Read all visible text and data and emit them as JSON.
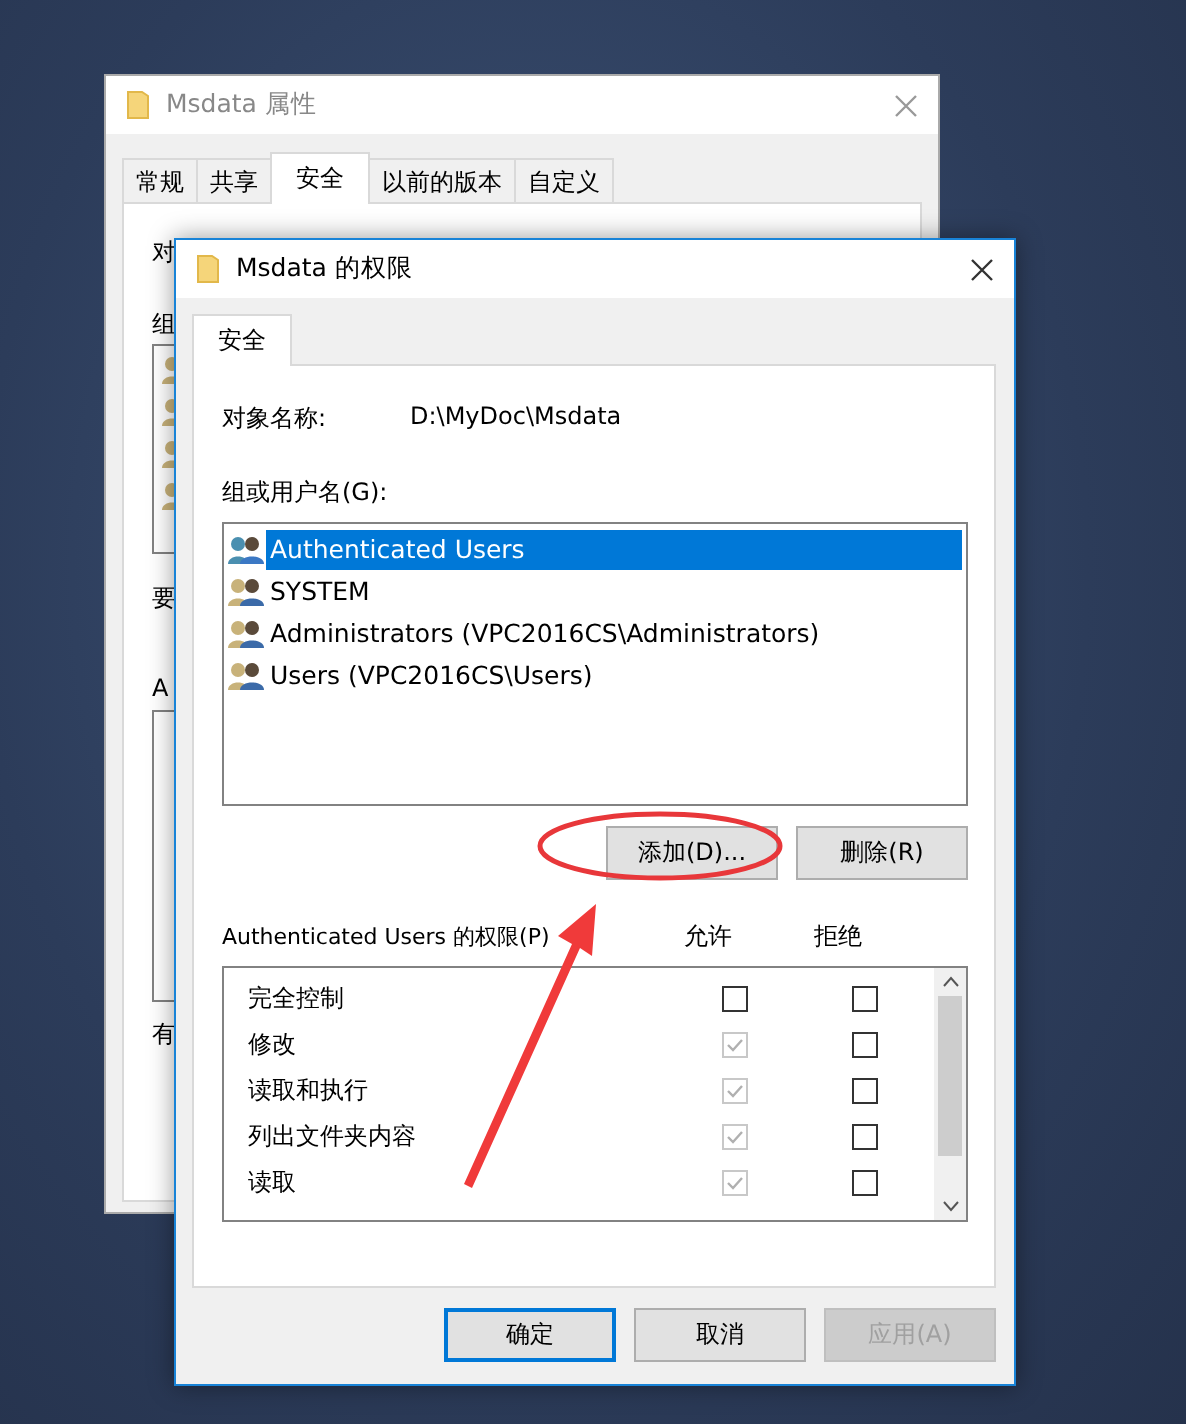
{
  "back_window": {
    "title": "Msdata 属性",
    "tabs": [
      {
        "label": "常规",
        "selected": false
      },
      {
        "label": "共享",
        "selected": false
      },
      {
        "label": "安全",
        "selected": true
      },
      {
        "label": "以前的版本",
        "selected": false
      },
      {
        "label": "自定义",
        "selected": false
      }
    ],
    "labels": [
      "对",
      "组",
      "要",
      "A",
      "有"
    ]
  },
  "dialog": {
    "title": "Msdata 的权限",
    "tabs": [
      {
        "label": "安全",
        "selected": true
      }
    ],
    "object_name_label": "对象名称:",
    "object_name": "D:\\MyDoc\\Msdata",
    "group_label": "组或用户名(G):",
    "users": [
      {
        "name": "Authenticated Users",
        "kind": "group",
        "selected": true
      },
      {
        "name": "SYSTEM",
        "kind": "user",
        "selected": false
      },
      {
        "name": "Administrators (VPC2016CS\\Administrators)",
        "kind": "user",
        "selected": false
      },
      {
        "name": "Users (VPC2016CS\\Users)",
        "kind": "user",
        "selected": false
      }
    ],
    "add_button": "添加(D)...",
    "remove_button": "删除(R)",
    "permissions_label": "Authenticated Users 的权限(P)",
    "allow_header": "允许",
    "deny_header": "拒绝",
    "permissions": [
      {
        "name": "完全控制",
        "allow_checked": false,
        "allow_disabled": false,
        "deny_checked": false
      },
      {
        "name": "修改",
        "allow_checked": true,
        "allow_disabled": true,
        "deny_checked": false
      },
      {
        "name": "读取和执行",
        "allow_checked": true,
        "allow_disabled": true,
        "deny_checked": false
      },
      {
        "name": "列出文件夹内容",
        "allow_checked": true,
        "allow_disabled": true,
        "deny_checked": false
      },
      {
        "name": "读取",
        "allow_checked": true,
        "allow_disabled": true,
        "deny_checked": false
      }
    ],
    "buttons": [
      {
        "label": "确定",
        "default": true,
        "disabled": false
      },
      {
        "label": "取消",
        "default": false,
        "disabled": false
      },
      {
        "label": "应用(A)",
        "default": false,
        "disabled": true
      }
    ]
  }
}
